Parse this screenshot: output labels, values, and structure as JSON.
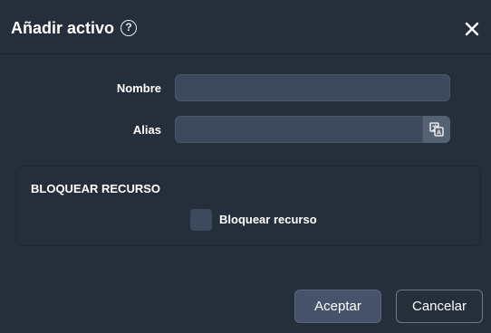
{
  "dialog": {
    "title": "Añadir activo",
    "help_icon": "question-circle-icon",
    "close_icon": "close-icon"
  },
  "form": {
    "name_label": "Nombre",
    "name_value": "",
    "alias_label": "Alias",
    "alias_value": "",
    "alias_button_icon": "translate-icon"
  },
  "lock_section": {
    "title": "BLOQUEAR RECURSO",
    "checkbox_label": "Bloquear recurso",
    "checked": false
  },
  "footer": {
    "accept_label": "Aceptar",
    "cancel_label": "Cancelar"
  },
  "colors": {
    "background": "#252e3b",
    "input_bg": "#3d4a5d",
    "primary_button": "#46536a"
  }
}
